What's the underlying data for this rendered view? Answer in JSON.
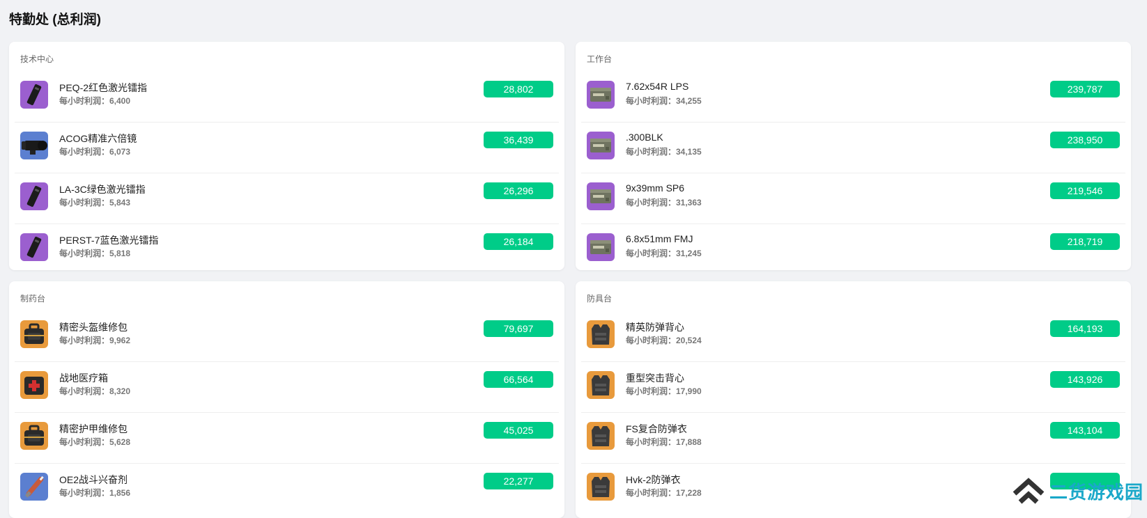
{
  "page": {
    "title": "特勤处 (总利润)"
  },
  "panels": {
    "tech": {
      "title": "技术中心",
      "items": [
        {
          "name": "PEQ-2红色激光镭指",
          "rate": "每小时利润：6,400",
          "profit": "28,802",
          "icon": "laser-sight-icon",
          "icon_bg": "#9b5fcf"
        },
        {
          "name": "ACOG精准六倍镜",
          "rate": "每小时利润：6,073",
          "profit": "36,439",
          "icon": "scope-icon",
          "icon_bg": "#5b7fd0"
        },
        {
          "name": "LA-3C绿色激光镭指",
          "rate": "每小时利润：5,843",
          "profit": "26,296",
          "icon": "laser-sight-icon",
          "icon_bg": "#9b5fcf"
        },
        {
          "name": "PERST-7蓝色激光镭指",
          "rate": "每小时利润：5,818",
          "profit": "26,184",
          "icon": "laser-sight-icon",
          "icon_bg": "#9b5fcf"
        }
      ]
    },
    "workbench": {
      "title": "工作台",
      "items": [
        {
          "name": "7.62x54R LPS",
          "rate": "每小时利润：34,255",
          "profit": "239,787",
          "icon": "ammo-box-icon",
          "icon_bg": "#9b5fcf"
        },
        {
          "name": ".300BLK",
          "rate": "每小时利润：34,135",
          "profit": "238,950",
          "icon": "ammo-box-icon",
          "icon_bg": "#9b5fcf"
        },
        {
          "name": "9x39mm SP6",
          "rate": "每小时利润：31,363",
          "profit": "219,546",
          "icon": "ammo-box-icon",
          "icon_bg": "#9b5fcf"
        },
        {
          "name": "6.8x51mm FMJ",
          "rate": "每小时利润：31,245",
          "profit": "218,719",
          "icon": "ammo-box-icon",
          "icon_bg": "#9b5fcf"
        }
      ]
    },
    "pharmacy": {
      "title": "制药台",
      "items": [
        {
          "name": "精密头盔维修包",
          "rate": "每小时利润：9,962",
          "profit": "79,697",
          "icon": "repair-kit-icon",
          "icon_bg": "#e89a3c"
        },
        {
          "name": "战地医疗箱",
          "rate": "每小时利润：8,320",
          "profit": "66,564",
          "icon": "medkit-icon",
          "icon_bg": "#e89a3c"
        },
        {
          "name": "精密护甲维修包",
          "rate": "每小时利润：5,628",
          "profit": "45,025",
          "icon": "repair-kit-icon",
          "icon_bg": "#e89a3c"
        },
        {
          "name": "OE2战斗兴奋剂",
          "rate": "每小时利润：1,856",
          "profit": "22,277",
          "icon": "syringe-icon",
          "icon_bg": "#5b7fd0"
        }
      ]
    },
    "armor": {
      "title": "防具台",
      "items": [
        {
          "name": "精英防弹背心",
          "rate": "每小时利润：20,524",
          "profit": "164,193",
          "icon": "vest-icon",
          "icon_bg": "#e89a3c"
        },
        {
          "name": "重型突击背心",
          "rate": "每小时利润：17,990",
          "profit": "143,926",
          "icon": "vest-icon",
          "icon_bg": "#e89a3c"
        },
        {
          "name": "FS复合防弹衣",
          "rate": "每小时利润：17,888",
          "profit": "143,104",
          "icon": "vest-icon",
          "icon_bg": "#e89a3c"
        },
        {
          "name": "Hvk-2防弹衣",
          "rate": "每小时利润：17,228",
          "profit": "",
          "icon": "vest-icon",
          "icon_bg": "#e89a3c"
        }
      ]
    }
  },
  "watermark": {
    "text": "二货游戏园",
    "color": "#1aa8c9"
  },
  "colors": {
    "badge": "#00cc88",
    "background": "#f1f2f5"
  }
}
